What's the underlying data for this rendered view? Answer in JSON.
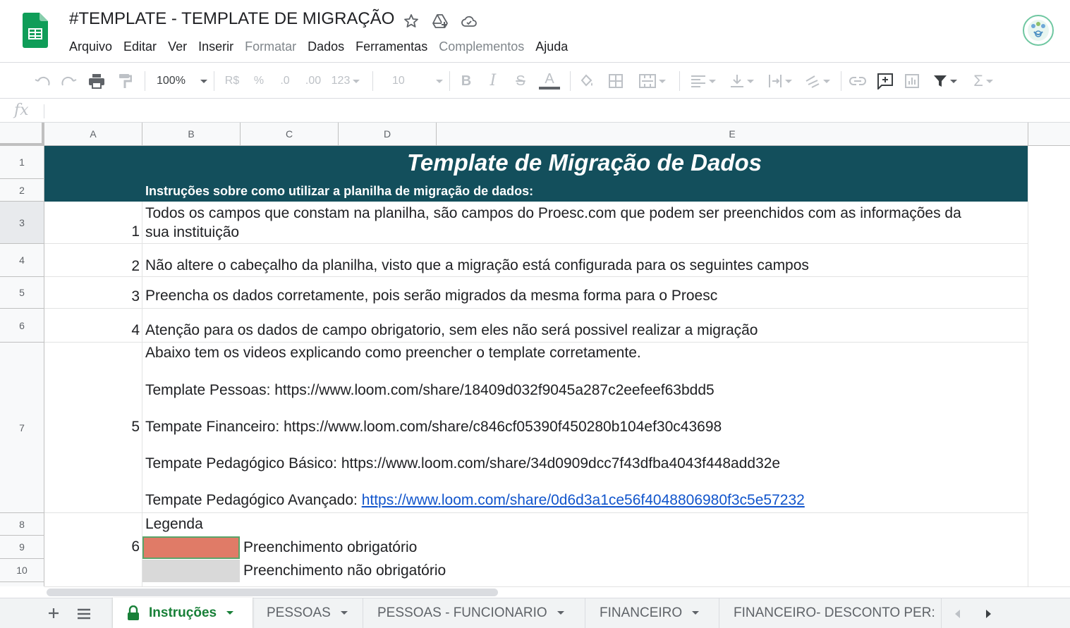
{
  "app": {
    "doc_title": "#TEMPLATE - TEMPLATE DE MIGRAÇÃO",
    "menu": [
      {
        "label": "Arquivo",
        "enabled": true
      },
      {
        "label": "Editar",
        "enabled": true
      },
      {
        "label": "Ver",
        "enabled": true
      },
      {
        "label": "Inserir",
        "enabled": true
      },
      {
        "label": "Formatar",
        "enabled": false
      },
      {
        "label": "Dados",
        "enabled": true
      },
      {
        "label": "Ferramentas",
        "enabled": true
      },
      {
        "label": "Complementos",
        "enabled": false
      },
      {
        "label": "Ajuda",
        "enabled": true
      }
    ]
  },
  "toolbar": {
    "zoom": "100%",
    "currency": "R$",
    "percent": "%",
    "decrease_decimals": ".0",
    "increase_decimals": ".00",
    "more_formats": "123",
    "font_size": "10",
    "bold": "B",
    "italic": "I",
    "strike": "S",
    "text_color": "A"
  },
  "formula_bar": {
    "fx": "fx",
    "value": ""
  },
  "grid": {
    "columns": [
      "A",
      "B",
      "C",
      "D",
      "E"
    ],
    "rows": [
      "1",
      "2",
      "3",
      "4",
      "5",
      "6",
      "7",
      "8",
      "9",
      "10"
    ],
    "banner_color": "#134f5c",
    "title": "Template de Migração de Dados",
    "subtitle": "Instruções sobre como utilizar a planilha de migração de dados:",
    "items": [
      {
        "num": "1",
        "line1": "Todos os campos que constam na planilha, são campos do Proesc.com que podem ser preenchidos com as informações da",
        "line2": "sua instituição"
      },
      {
        "num": "2",
        "text": "Não altere o cabeçalho da planilha, visto que a migração está configurada para os seguintes campos"
      },
      {
        "num": "3",
        "text": "Preencha os dados corretamente, pois serão migrados da mesma forma para o Proesc"
      },
      {
        "num": "4",
        "text": "Atenção para os dados de campo obrigatorio, sem eles não será possivel realizar a migração"
      },
      {
        "num": "5",
        "intro": "Abaixo tem os videos explicando como preencher o template corretamente.",
        "videos": [
          "Template Pessoas: https://www.loom.com/share/18409d032f9045a287c2eefeef63bdd5",
          "Tempate Financeiro: https://www.loom.com/share/c846cf05390f450280b104ef30c43698",
          "Tempate Pedagógico Básico: https://www.loom.com/share/34d0909dcc7f43dfba4043f448add32e"
        ],
        "advanced_label": "Tempate Pedagógico Avançado:",
        "advanced_link": "https://www.loom.com/share/0d6d3a1ce56f4048806980f3c5e57232"
      },
      {
        "num": "6",
        "legend_title": "Legenda",
        "legend_required": "Preenchimento obrigatório",
        "legend_optional": "Preenchimento não obrigatório",
        "required_color": "#e07b67",
        "optional_color": "#d9d9d9"
      }
    ]
  },
  "sheet_tabs": [
    {
      "label": "Instruções",
      "active": true,
      "locked": true
    },
    {
      "label": "PESSOAS",
      "active": false
    },
    {
      "label": "PESSOAS - FUNCIONARIO",
      "active": false
    },
    {
      "label": "FINANCEIRO",
      "active": false
    },
    {
      "label": "FINANCEIRO- DESCONTO PER:",
      "active": false
    }
  ]
}
